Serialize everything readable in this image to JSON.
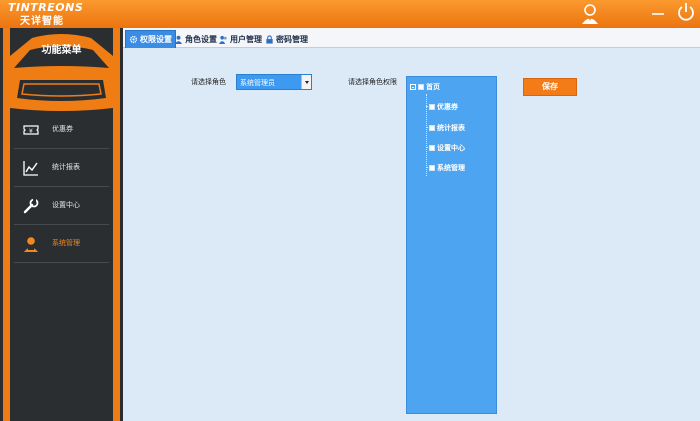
{
  "header": {
    "logo_en": "TINTREONS",
    "logo_cn": "天详智能",
    "accent": "#ef7d14"
  },
  "sidebar": {
    "title": "功能菜单",
    "items": [
      {
        "label": "优惠券",
        "icon": "ticket-icon",
        "active": false
      },
      {
        "label": "统计报表",
        "icon": "line-chart-icon",
        "active": false
      },
      {
        "label": "设置中心",
        "icon": "wrench-icon",
        "active": false
      },
      {
        "label": "系统管理",
        "icon": "admin-user-icon",
        "active": true
      }
    ]
  },
  "tabs": [
    {
      "label": "权限设置",
      "icon": "gear-icon",
      "active": true
    },
    {
      "label": "角色设置",
      "icon": "person-icon",
      "active": false
    },
    {
      "label": "用户管理",
      "icon": "users-icon",
      "active": false
    },
    {
      "label": "密码管理",
      "icon": "lock-icon",
      "active": false
    }
  ],
  "form": {
    "role_label": "请选择角色",
    "role_value": "系统管理员",
    "perm_label": "请选择角色权限",
    "save_label": "保存"
  },
  "tree": {
    "root": "首页",
    "children": [
      "优惠券",
      "统计报表",
      "设置中心",
      "系统管理"
    ]
  },
  "colors": {
    "orange": "#ef7d14",
    "sidebar_bg": "#2b2e31",
    "tree_bg": "#4da4f1",
    "content_bg": "#dce9f6"
  }
}
